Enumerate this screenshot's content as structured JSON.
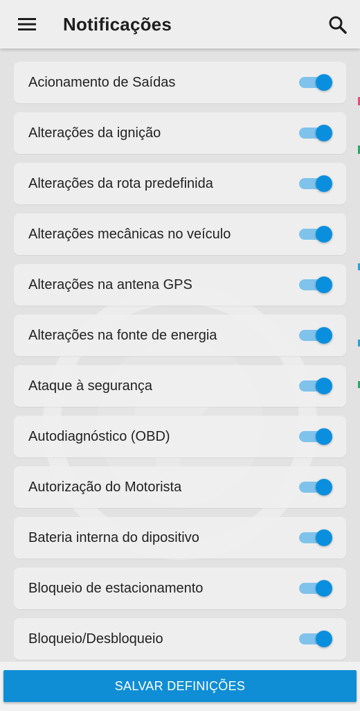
{
  "appbar": {
    "title": "Notificações",
    "menu_icon": "hamburger-menu-icon",
    "search_icon": "search-icon"
  },
  "colors": {
    "accent": "#0f8ed6",
    "toggle_thumb": "#0a8fdf",
    "toggle_track": "#7fc3ec"
  },
  "notifications": [
    {
      "label": "Acionamento de Saídas",
      "enabled": true
    },
    {
      "label": "Alterações da ignição",
      "enabled": true
    },
    {
      "label": "Alterações da rota predefinida",
      "enabled": true
    },
    {
      "label": "Alterações mecânicas no veículo",
      "enabled": true
    },
    {
      "label": "Alterações na antena GPS",
      "enabled": true
    },
    {
      "label": "Alterações na fonte de energia",
      "enabled": true
    },
    {
      "label": "Ataque à segurança",
      "enabled": true
    },
    {
      "label": "Autodiagnóstico (OBD)",
      "enabled": true
    },
    {
      "label": "Autorização do Motorista",
      "enabled": true
    },
    {
      "label": "Bateria interna do dipositivo",
      "enabled": true
    },
    {
      "label": "Bloqueio de estacionamento",
      "enabled": true
    },
    {
      "label": "Bloqueio/Desbloqueio",
      "enabled": true
    }
  ],
  "footer": {
    "save_label": "SALVAR DEFINIÇÕES"
  }
}
